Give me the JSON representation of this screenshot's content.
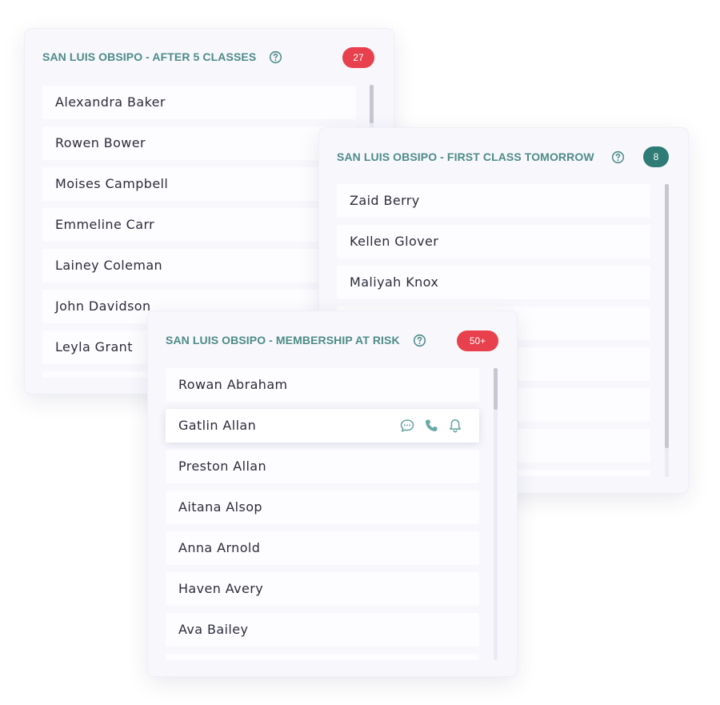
{
  "cards": {
    "after_five": {
      "title": "SAN LUIS OBSIPO - AFTER 5 CLASSES",
      "badge": "27",
      "badge_color": "#e8404c",
      "members": [
        "Alexandra Baker",
        "Rowen Bower",
        "Moises Campbell",
        "Emmeline Carr",
        "Lainey Coleman",
        "John Davidson",
        "Leyla Grant"
      ]
    },
    "first_class": {
      "title": "SAN LUIS OBSIPO - FIRST CLASS TOMORROW",
      "badge": "8",
      "badge_color": "#2f7b76",
      "members": [
        "Zaid Berry",
        "Kellen Glover",
        "Maliyah Knox"
      ]
    },
    "at_risk": {
      "title": "SAN LUIS OBSIPO - MEMBERSHIP AT RISK",
      "badge": "50+",
      "badge_color": "#e8404c",
      "members": [
        "Rowan Abraham",
        "Gatlin Allan",
        "Preston Allan",
        "Aitana Alsop",
        "Anna Arnold",
        "Haven Avery",
        "Ava Bailey"
      ],
      "row_actions": [
        "message-icon",
        "phone-icon",
        "bell-icon"
      ]
    }
  },
  "colors": {
    "accent_teal": "#4e8c88",
    "badge_red": "#e8404c",
    "badge_teal": "#2f7b76"
  }
}
